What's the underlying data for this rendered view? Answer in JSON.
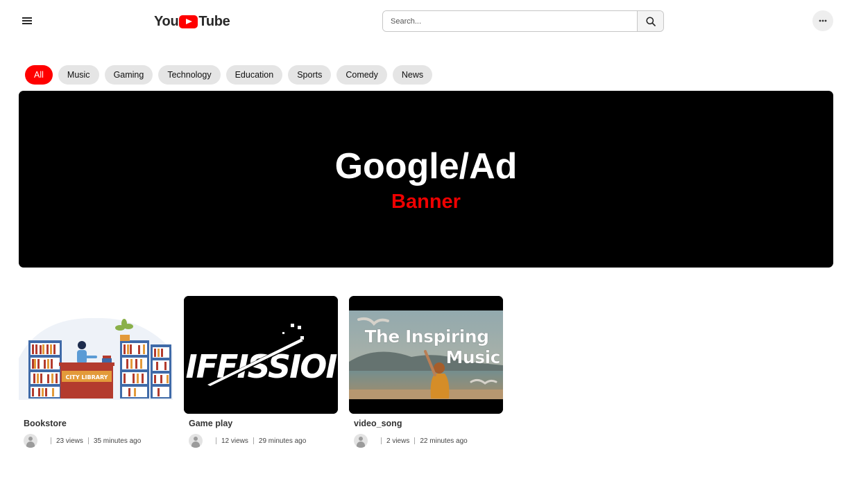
{
  "header": {
    "logo_left": "You",
    "logo_right": "Tube",
    "search_placeholder": "Search..."
  },
  "chips": [
    {
      "label": "All",
      "active": true
    },
    {
      "label": "Music",
      "active": false
    },
    {
      "label": "Gaming",
      "active": false
    },
    {
      "label": "Technology",
      "active": false
    },
    {
      "label": "Education",
      "active": false
    },
    {
      "label": "Sports",
      "active": false
    },
    {
      "label": "Comedy",
      "active": false
    },
    {
      "label": "News",
      "active": false
    }
  ],
  "banner": {
    "title": "Google/Ad",
    "subtitle": "Banner"
  },
  "videos": [
    {
      "title": "Bookstore",
      "views": "23 views",
      "time": "35 minutes ago",
      "thumb_text": "CITY LIBRARY"
    },
    {
      "title": "Game play",
      "views": "12 views",
      "time": "29 minutes ago",
      "thumb_text": "IFFISSIOI"
    },
    {
      "title": "video_song",
      "views": "2 views",
      "time": "22 minutes ago",
      "thumb_text_1": "The Inspiring",
      "thumb_text_2": "Music"
    }
  ],
  "colors": {
    "accent": "#ff0000",
    "chip_bg": "#e5e5e5",
    "banner_bg": "#000000",
    "banner_subtitle": "#ee0000"
  }
}
